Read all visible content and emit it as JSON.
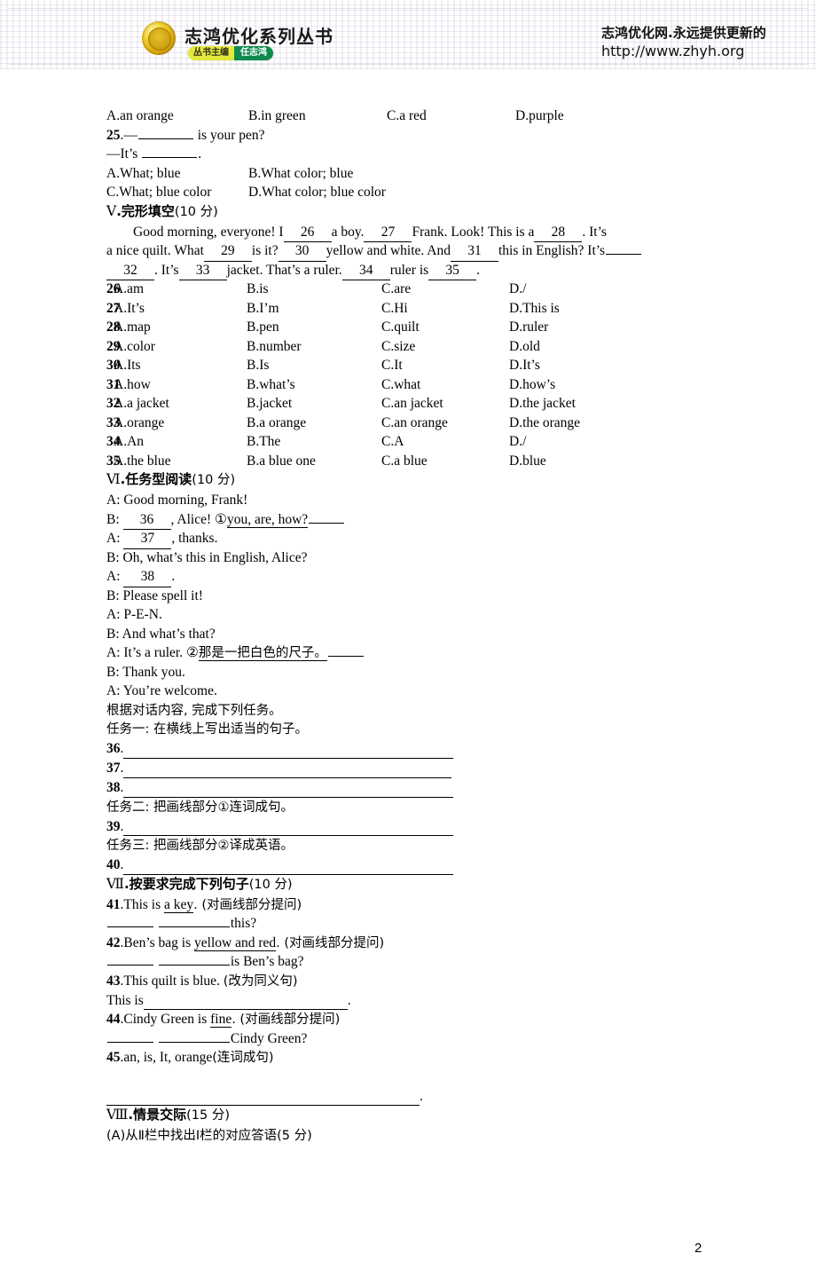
{
  "header": {
    "logo_alt": "志鸿优化系列丛书金质印章",
    "brand_title": "志鸿优化系列丛书",
    "badge_left": "丛书主编",
    "badge_right": "任志鸿",
    "slogan": "志鸿优化网.永远提供更新的",
    "url": "http://www.zhyh.org"
  },
  "q24_options": {
    "A": "A.an orange",
    "B": "B.in green",
    "C": "C.a red",
    "D": "D.purple"
  },
  "q25": {
    "number": "25",
    "stem": ".—",
    "stem_tail": " is your pen?",
    "answer_lead": "—It’s ",
    "answer_tail": ".",
    "options": [
      {
        "A": "A.What; blue",
        "B": "B.What color; blue"
      },
      {
        "A": "C.What; blue color",
        "B": "D.What color; blue color"
      }
    ]
  },
  "section5": {
    "heading_roman": "Ⅴ",
    "heading_cn": ".完形填空",
    "heading_score": "(10 分)",
    "passage": {
      "l1_a": "Good morning, everyone! I",
      "l1_n1": "26",
      "l1_b": "a boy.",
      "l1_n2": "27",
      "l1_c": "Frank. Look! This is a",
      "l1_n3": "28",
      "l1_d": ". It’s",
      "l2_a": "a nice quilt. What",
      "l2_n1": "29",
      "l2_b": "is it?",
      "l2_n2": "30",
      "l2_c": "yellow and white. And",
      "l2_n3": "31",
      "l2_d": "this in English? It’s",
      "l3_n1": "32",
      "l3_a": ". It’s",
      "l3_n2": "33",
      "l3_b": "jacket. That’s a ruler.",
      "l3_n3": "34",
      "l3_c": "ruler is",
      "l3_n4": "35",
      "l3_d": "."
    },
    "questions": [
      {
        "n": "26",
        "A": "A.am",
        "B": "B.is",
        "C": "C.are",
        "D": "D./"
      },
      {
        "n": "27",
        "A": "A.It’s",
        "B": "B.I’m",
        "C": "C.Hi",
        "D": "D.This is"
      },
      {
        "n": "28",
        "A": "A.map",
        "B": "B.pen",
        "C": "C.quilt",
        "D": "D.ruler"
      },
      {
        "n": "29",
        "A": "A.color",
        "B": "B.number",
        "C": "C.size",
        "D": "D.old"
      },
      {
        "n": "30",
        "A": "A.Its",
        "B": "B.Is",
        "C": "C.It",
        "D": "D.It’s"
      },
      {
        "n": "31",
        "A": "A.how",
        "B": "B.what’s",
        "C": "C.what",
        "D": "D.how’s"
      },
      {
        "n": "32",
        "A": "A.a jacket",
        "B": "B.jacket",
        "C": "C.an jacket",
        "D": "D.the jacket"
      },
      {
        "n": "33",
        "A": "A.orange",
        "B": "B.a orange",
        "C": "C.an orange",
        "D": "D.the orange"
      },
      {
        "n": "34",
        "A": "A.An",
        "B": "B.The",
        "C": "C.A",
        "D": "D./"
      },
      {
        "n": "35",
        "A": "A.the blue",
        "B": "B.a blue one",
        "C": "C.a blue",
        "D": "D.blue"
      }
    ]
  },
  "section6": {
    "heading_roman": "Ⅵ",
    "heading_cn": ".任务型阅读",
    "heading_score": "(10 分)",
    "dialogue": {
      "d1": "A: Good morning, Frank!",
      "d2_a": "B: ",
      "d2_n": "36",
      "d2_b": ", Alice! ①",
      "d2_underlined": "you, are, how?",
      "d3_a": "A: ",
      "d3_n": "37",
      "d3_b": ", thanks.",
      "d4": "B: Oh, what’s this in English, Alice?",
      "d5_a": "A: ",
      "d5_n": "38",
      "d5_b": ".",
      "d6": "B: Please spell it!",
      "d7": "A: P-E-N.",
      "d8": "B: And what’s that?",
      "d9_a": "A: It’s a ruler. ②",
      "d9_underlined": "那是一把白色的尺子。",
      "d10": "B: Thank you.",
      "d11": "A: You’re welcome."
    },
    "instruction": "根据对话内容, 完成下列任务。",
    "task1": "任务一: 在横线上写出适当的句子。",
    "blanks_1": [
      "36",
      "37",
      "38"
    ],
    "task2": "任务二: 把画线部分①连词成句。",
    "blanks_2": [
      "39"
    ],
    "task3": "任务三: 把画线部分②译成英语。",
    "blanks_3": [
      "40"
    ]
  },
  "section7": {
    "heading_roman": "Ⅶ",
    "heading_cn": ".按要求完成下列句子",
    "heading_score": "(10 分)",
    "items": [
      {
        "n": "41",
        "stem_a": ".This is ",
        "stem_ul": "a key",
        "stem_b": ". (对画线部分提问)",
        "answer_tail": "this?"
      },
      {
        "n": "42",
        "stem_a": ".Ben’s bag is ",
        "stem_ul": "yellow and red",
        "stem_b": ". (对画线部分提问)",
        "answer_tail": "is Ben’s bag?"
      },
      {
        "n": "43",
        "stem_a": ".This quilt is blue. ",
        "stem_cn": "(改为同义句)",
        "answer_lead": "This is ",
        "answer_tail": "."
      },
      {
        "n": "44",
        "stem_a": ".Cindy Green is ",
        "stem_ul": "fine",
        "stem_b": ". (对画线部分提问)",
        "answer_tail": "Cindy Green?"
      },
      {
        "n": "45",
        "stem_a": ".an, is, It, orange",
        "stem_cn": "(连词成句)",
        "answer_tail": "."
      }
    ]
  },
  "section8": {
    "heading_roman": "Ⅷ",
    "heading_cn": ".情景交际",
    "heading_score": "(15 分)",
    "subsection": "(A)从Ⅱ栏中找出Ⅰ栏的对应答语(5 分)"
  },
  "footer": {
    "page_number": "2"
  }
}
